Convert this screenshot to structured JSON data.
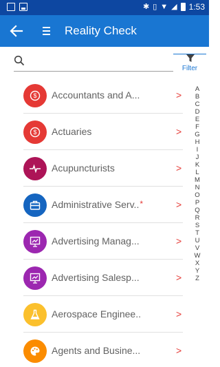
{
  "status_bar": {
    "time": "1:53"
  },
  "app_bar": {
    "title": "Reality Check"
  },
  "search": {
    "placeholder": "",
    "value": ""
  },
  "filter": {
    "label": "Filter"
  },
  "list": {
    "items": [
      {
        "label": "Accountants and A...",
        "icon": "dollar-icon",
        "color": "#e53935",
        "star": false
      },
      {
        "label": "Actuaries",
        "icon": "dollar-icon",
        "color": "#e53935",
        "star": false
      },
      {
        "label": "Acupuncturists",
        "icon": "heartbeat-icon",
        "color": "#ad1457",
        "star": false
      },
      {
        "label": "Administrative Serv..",
        "icon": "briefcase-icon",
        "color": "#1565c0",
        "star": true
      },
      {
        "label": "Advertising Manag...",
        "icon": "presentation-icon",
        "color": "#9c27b0",
        "star": false
      },
      {
        "label": "Advertising Salesp...",
        "icon": "presentation-icon",
        "color": "#9c27b0",
        "star": false
      },
      {
        "label": "Aerospace Enginee..",
        "icon": "flask-icon",
        "color": "#fbc02d",
        "star": false
      },
      {
        "label": "Agents and Busine...",
        "icon": "palette-icon",
        "color": "#fb8c00",
        "star": false
      }
    ],
    "chevron": ">",
    "star": "*"
  },
  "alphabet": [
    "A",
    "B",
    "C",
    "D",
    "E",
    "F",
    "G",
    "H",
    "I",
    "J",
    "K",
    "L",
    "M",
    "N",
    "O",
    "P",
    "Q",
    "R",
    "S",
    "T",
    "U",
    "V",
    "W",
    "X",
    "Y",
    "Z"
  ]
}
